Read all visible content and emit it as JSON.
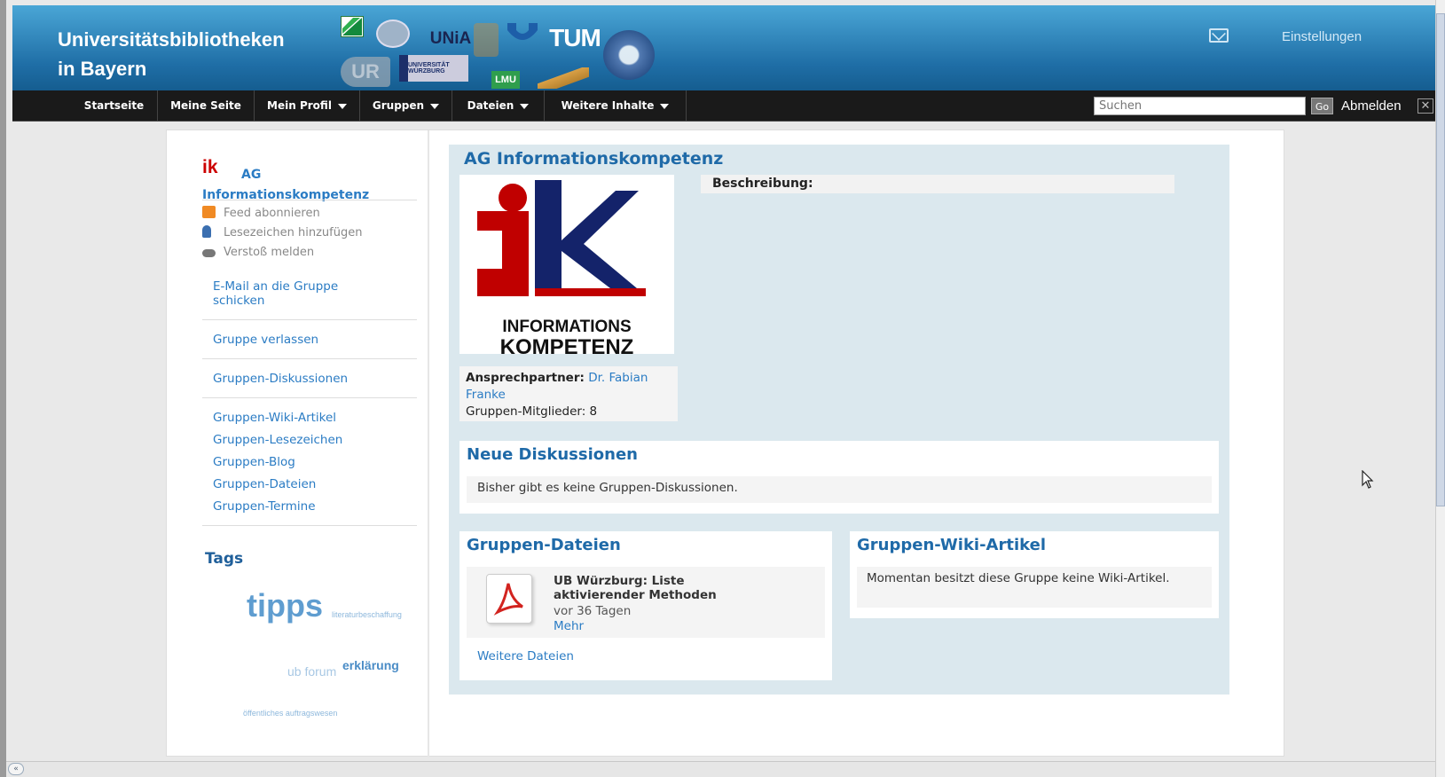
{
  "header": {
    "site_title_line1": "Universitätsbibliotheken",
    "site_title_line2": "in Bayern",
    "settings_label": "Einstellungen",
    "logos": [
      "UNiA",
      "TUM",
      "UR",
      "UNIVERSITÄT WÜRZBURG",
      "LMU"
    ]
  },
  "navbar": {
    "items": [
      {
        "label": "Startseite",
        "dropdown": false
      },
      {
        "label": "Meine Seite",
        "dropdown": false
      },
      {
        "label": "Mein Profil",
        "dropdown": true
      },
      {
        "label": "Gruppen",
        "dropdown": true
      },
      {
        "label": "Dateien",
        "dropdown": true
      },
      {
        "label": "Weitere Inhalte",
        "dropdown": true
      }
    ],
    "search_placeholder": "Suchen",
    "go_label": "Go",
    "logout_label": "Abmelden"
  },
  "sidebar": {
    "owner_icon_text": "ik",
    "owner_name": "AG Informationskompetenz",
    "actions": [
      {
        "label": "Feed abonnieren",
        "icon": "rss-icon"
      },
      {
        "label": "Lesezeichen hinzufügen",
        "icon": "bookmark-icon"
      },
      {
        "label": "Verstoß melden",
        "icon": "report-icon"
      }
    ],
    "links": {
      "email": "E-Mail an die Gruppe schicken",
      "leave": "Gruppe verlassen",
      "discussions": "Gruppen-Diskussionen",
      "wiki": "Gruppen-Wiki-Artikel",
      "bookmarks": "Gruppen-Lesezeichen",
      "blog": "Gruppen-Blog",
      "files": "Gruppen-Dateien",
      "events": "Gruppen-Termine"
    },
    "tags_title": "Tags",
    "tags": [
      "tipps",
      "literaturbeschaffung",
      "erklärung",
      "ub forum",
      "öffentliches auftragswesen"
    ]
  },
  "main": {
    "title": "AG Informationskompetenz",
    "logo_line1": "INFORMATIONS",
    "logo_line2": "KOMPETENZ",
    "description_label": "Beschreibung:",
    "contact_label": "Ansprechpartner:",
    "contact_name": "Dr. Fabian Franke",
    "members_label": "Gruppen-Mitglieder:",
    "members_count": "8",
    "discussions": {
      "title": "Neue Diskussionen",
      "empty_text": "Bisher gibt es keine Gruppen-Diskussionen."
    },
    "files": {
      "title": "Gruppen-Dateien",
      "file_title": "UB Würzburg: Liste aktivierender Methoden",
      "file_age": "vor 36 Tagen",
      "more_label": "Mehr",
      "all_files_label": "Weitere Dateien"
    },
    "wiki": {
      "title": "Gruppen-Wiki-Artikel",
      "empty_text": "Momentan besitzt diese Gruppe keine Wiki-Artikel."
    }
  },
  "colors": {
    "header_gradient_top": "#4aa6d6",
    "header_gradient_bottom": "#155d90",
    "navbar": "#1a1a1a",
    "link": "#2b7cc4",
    "heading": "#1f6aa8",
    "main_bg": "#dbe8ee",
    "ik_red": "#c00000",
    "ik_navy": "#14236a"
  }
}
